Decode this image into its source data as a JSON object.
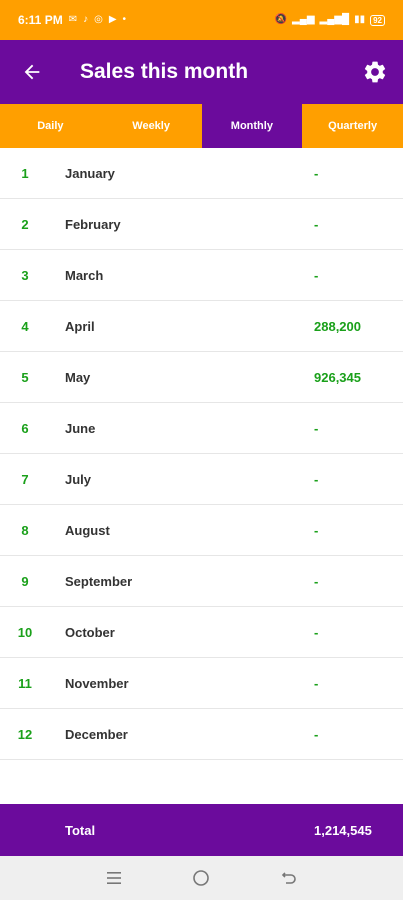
{
  "status_bar": {
    "time": "6:11 PM",
    "battery": "92",
    "left_icons": [
      "mail-icon",
      "tiktok-icon",
      "whatsapp-icon",
      "youtube-icon",
      "dot-icon"
    ],
    "right_icons": [
      "mute-icon",
      "signal-icon",
      "wifi-signal-icon",
      "lte-icon",
      "battery-icon"
    ]
  },
  "app_bar": {
    "title": "Sales this month",
    "back_icon": "arrow-left-icon",
    "settings_icon": "gear-icon"
  },
  "tabs": [
    {
      "label": "Daily",
      "active": false
    },
    {
      "label": "Weekly",
      "active": false
    },
    {
      "label": "Monthly",
      "active": true
    },
    {
      "label": "Quarterly",
      "active": false
    }
  ],
  "rows": [
    {
      "num": "1",
      "month": "January",
      "value": "-"
    },
    {
      "num": "2",
      "month": "February",
      "value": "-"
    },
    {
      "num": "3",
      "month": "March",
      "value": "-"
    },
    {
      "num": "4",
      "month": "April",
      "value": "288,200"
    },
    {
      "num": "5",
      "month": "May",
      "value": "926,345"
    },
    {
      "num": "6",
      "month": "June",
      "value": "-"
    },
    {
      "num": "7",
      "month": "July",
      "value": "-"
    },
    {
      "num": "8",
      "month": "August",
      "value": "-"
    },
    {
      "num": "9",
      "month": "September",
      "value": "-"
    },
    {
      "num": "10",
      "month": "October",
      "value": "-"
    },
    {
      "num": "11",
      "month": "November",
      "value": "-"
    },
    {
      "num": "12",
      "month": "December",
      "value": "-"
    }
  ],
  "total": {
    "label": "Total",
    "value": "1,214,545"
  },
  "nav_bar": {
    "icons": [
      "menu-icon",
      "home-circle-icon",
      "back-icon"
    ]
  },
  "colors": {
    "primary_purple": "#6b0b9c",
    "accent_orange": "#ff9f00",
    "value_green": "#1aa01a"
  }
}
